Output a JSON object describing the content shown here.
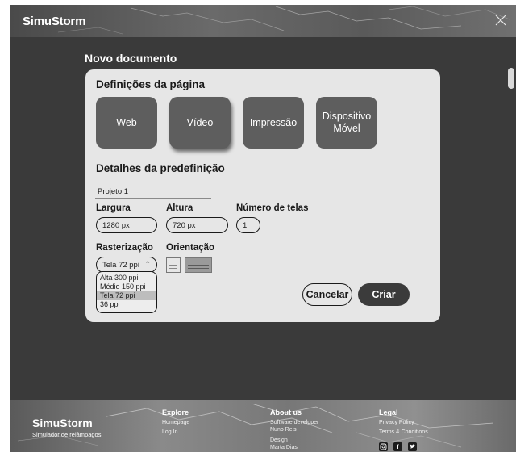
{
  "app": {
    "brand": "SimuStorm"
  },
  "page": {
    "title": "Novo documento"
  },
  "dialog": {
    "page_settings": {
      "title": "Definições da página",
      "options": [
        {
          "label": "Web",
          "selected": false
        },
        {
          "label": "Vídeo",
          "selected": true
        },
        {
          "label": "Impressão",
          "selected": false
        },
        {
          "label": "Dispositivo Móvel",
          "selected": false
        }
      ]
    },
    "preset": {
      "title": "Detalhes da predefinição",
      "name": "Projeto 1"
    },
    "width": {
      "label": "Largura",
      "value": "1280 px"
    },
    "height": {
      "label": "Altura",
      "value": "720 px"
    },
    "screens": {
      "label": "Número de telas",
      "value": "1"
    },
    "rasterization": {
      "label": "Rasterização",
      "selected": "Tela 72 ppi",
      "options": [
        "Alta 300 ppi",
        "Médio 150 ppi",
        "Tela 72 ppi",
        "36 ppi"
      ]
    },
    "orientation": {
      "label": "Orientação",
      "selected": "landscape"
    },
    "cancel_label": "Cancelar",
    "create_label": "Criar"
  },
  "footer": {
    "brand": "SimuStorm",
    "tagline": "Simulador de relâmpagos",
    "explore": {
      "title": "Explore",
      "links": [
        "Homepage",
        "Log In"
      ]
    },
    "about": {
      "title": "About us",
      "role1": "Software developer",
      "name1": "Nuno Reis",
      "role2": "Design",
      "name2": "Marta Dias"
    },
    "legal": {
      "title": "Legal",
      "links": [
        "Privacy Policy",
        "Terms & Conditions"
      ]
    },
    "social_icons": [
      "instagram-icon",
      "facebook-icon",
      "twitter-icon"
    ]
  },
  "colors": {
    "background": "#3a3a3a",
    "dialog": "#e6e6e6",
    "tile": "#5e5e5e",
    "primary_button": "#3b3b3b"
  }
}
